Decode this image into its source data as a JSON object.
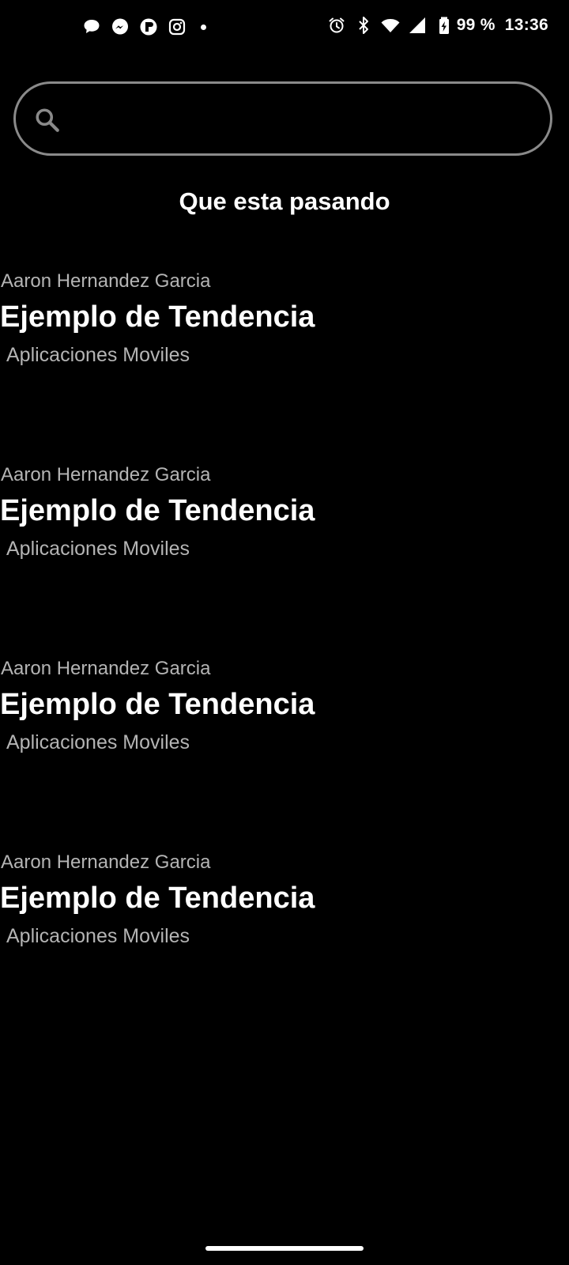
{
  "status_bar": {
    "notification_icons": [
      "chat-bubble-icon",
      "messenger-icon",
      "facebook-lite-icon",
      "instagram-icon"
    ],
    "system_icons": [
      "alarm-icon",
      "bluetooth-icon",
      "wifi-icon",
      "cell-signal-icon",
      "battery-charging-icon"
    ],
    "battery_text": "99 %",
    "time": "13:36"
  },
  "search": {
    "value": "",
    "placeholder": ""
  },
  "section": {
    "title": "Que esta pasando"
  },
  "trends": [
    {
      "author": "Aaron Hernandez Garcia",
      "title": "Ejemplo de Tendencia",
      "category": " Aplicaciones Moviles"
    },
    {
      "author": "Aaron Hernandez Garcia",
      "title": "Ejemplo de Tendencia",
      "category": " Aplicaciones Moviles"
    },
    {
      "author": "Aaron Hernandez Garcia",
      "title": "Ejemplo de Tendencia",
      "category": " Aplicaciones Moviles"
    },
    {
      "author": "Aaron Hernandez Garcia",
      "title": "Ejemplo de Tendencia",
      "category": " Aplicaciones Moviles"
    }
  ],
  "colors": {
    "background": "#000000",
    "primary_text": "#ffffff",
    "secondary_text": "#b4b4b4",
    "search_border": "#8a8a8a"
  }
}
